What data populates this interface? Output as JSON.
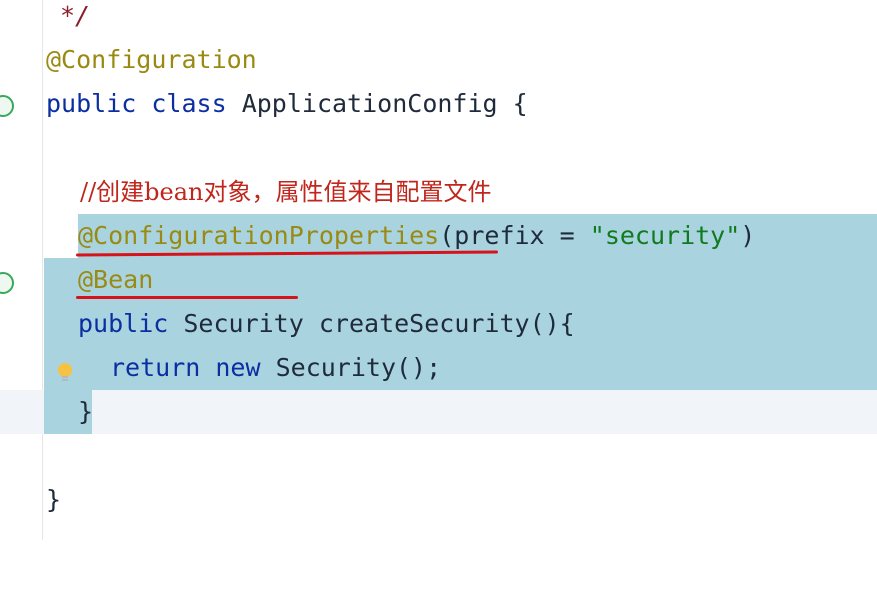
{
  "editor": {
    "lines": {
      "comment_end": "*/",
      "config_annotation": "@Configuration",
      "class_kw_public": "public",
      "class_kw_class": "class",
      "class_name": "ApplicationConfig",
      "class_open": "{",
      "chinese_comment": "//创建bean对象，属性值来自配置文件",
      "props_annotation": "@ConfigurationProperties",
      "props_paren_open": "(",
      "props_param": "prefix",
      "props_eq": " = ",
      "props_value": "\"security\"",
      "props_paren_close": ")",
      "bean_annotation": "@Bean",
      "method_kw_public": "public",
      "method_type": "Security",
      "method_name": "createSecurity(){",
      "return_kw": "return",
      "new_kw": "new",
      "return_expr": "Security();",
      "method_close": "}",
      "class_close": "}"
    },
    "icons": {
      "class_gutter": "bean-gutter-icon",
      "method_gutter": "bean-gutter-icon",
      "hint": "lightbulb-icon"
    },
    "colors": {
      "selection": "#a9d4df",
      "keyword": "#0b2fa0",
      "annotation": "#9a8a14",
      "string": "#0f7a1f",
      "comment": "#c0271c",
      "underline": "#d6131a"
    }
  }
}
